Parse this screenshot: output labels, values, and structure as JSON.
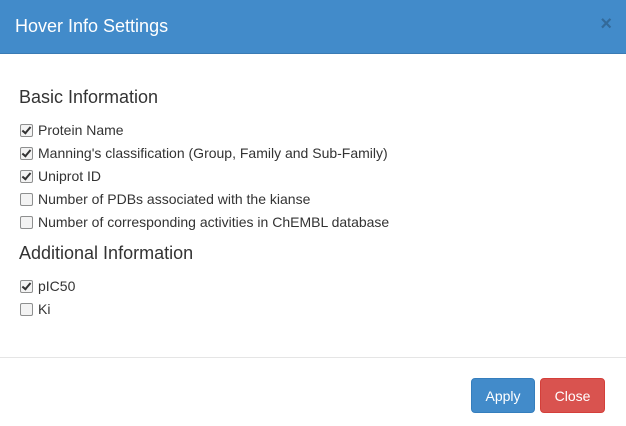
{
  "header": {
    "title": "Hover Info Settings",
    "close_symbol": "×"
  },
  "basic": {
    "heading": "Basic Information",
    "options": [
      {
        "label": "Protein Name",
        "checked": true
      },
      {
        "label": "Manning's classification (Group, Family and Sub-Family)",
        "checked": true
      },
      {
        "label": "Uniprot ID",
        "checked": true
      },
      {
        "label": "Number of PDBs associated with the kianse",
        "checked": false
      },
      {
        "label": "Number of corresponding activities in ChEMBL database",
        "checked": false
      }
    ]
  },
  "additional": {
    "heading": "Additional Information",
    "options": [
      {
        "label": "pIC50",
        "checked": true
      },
      {
        "label": "Ki",
        "checked": false
      }
    ]
  },
  "footer": {
    "apply_label": "Apply",
    "close_label": "Close"
  },
  "colors": {
    "header_bg": "#428bca",
    "apply_bg": "#428bca",
    "close_bg": "#d9534f"
  }
}
